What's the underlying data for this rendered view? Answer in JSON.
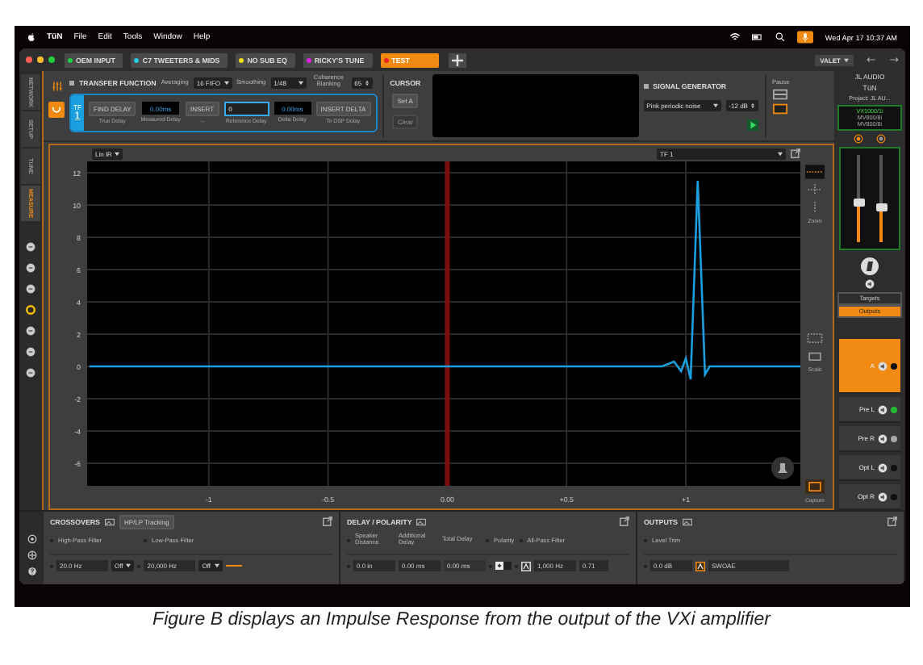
{
  "menu_bar": {
    "app_name": "TüN",
    "items": [
      "File",
      "Edit",
      "Tools",
      "Window",
      "Help"
    ],
    "clock": "Wed Apr 17  10:37 AM"
  },
  "tabs": [
    {
      "label": "OEM INPUT",
      "color": "#22cc44",
      "selected": false
    },
    {
      "label": "C7 TWEETERS & MIDS",
      "color": "#22ccdd",
      "selected": false
    },
    {
      "label": "NO SUB EQ",
      "color": "#eedd22",
      "selected": false
    },
    {
      "label": "RICKY'S TUNE",
      "color": "#dd22dd",
      "selected": false
    },
    {
      "label": "TEST",
      "color": "#ee2222",
      "selected": true
    }
  ],
  "account": "VALET",
  "side_nav": [
    {
      "label": "NETWORK",
      "selected": false
    },
    {
      "label": "SETUP",
      "selected": false
    },
    {
      "label": "TUNE",
      "selected": false
    },
    {
      "label": "MEASURE",
      "selected": true
    }
  ],
  "transfer_function": {
    "title": "TRANSFER FUNCTION",
    "averaging_label": "Averaging",
    "averaging": "16 FIFO",
    "smoothing_label": "Smoothing",
    "smoothing": "1/48",
    "coherence_label": "Coherence Blanking",
    "coherence": "65",
    "tf_label": "TF",
    "tf_number": "1",
    "find_delay": "FIND DELAY",
    "find_delay_caption": "True Delay",
    "measured": "0.00ms",
    "measured_caption": "Measured Delay",
    "insert": "INSERT",
    "insert_caption": "→",
    "reference": "0",
    "reference_caption": "Reference Delay",
    "delta": "0.00ms",
    "delta_caption": "Delta Delay",
    "insert_delta": "INSERT DELTA",
    "insert_delta_caption": "To DSP Delay"
  },
  "cursor": {
    "title": "CURSOR",
    "set": "Set A",
    "clear": "Clear",
    "clear_disabled": true
  },
  "signal_generator": {
    "title": "SIGNAL GENERATOR",
    "signal": "Pink periodic noise",
    "level": "-12 dB",
    "pause_label": "Pause"
  },
  "chart": {
    "view": "Lin IR",
    "zoom_label": "Zoom",
    "scale_label": "Scale",
    "capture_label": "Capture",
    "chart_data": {
      "type": "line",
      "grid": true,
      "x": [
        -1.5,
        0.9,
        0.95,
        0.98,
        1.0,
        1.02,
        1.05,
        1.08,
        1.1,
        1.48
      ],
      "series": [
        {
          "name": "TF 1",
          "color": "#1a9fe0",
          "values": [
            0,
            0,
            0.3,
            -0.3,
            0.5,
            -0.8,
            11.5,
            -0.5,
            0,
            0
          ]
        }
      ],
      "xlim": [
        -1.51,
        1.48
      ],
      "ylim": [
        -7.4,
        12.7
      ],
      "xticks": [
        {
          "value": -1,
          "label": "-1"
        },
        {
          "value": -0.5,
          "label": "-0.5"
        },
        {
          "value": 0,
          "label": "0.00"
        },
        {
          "value": 0.5,
          "label": "+0.5"
        },
        {
          "value": 1,
          "label": "+1"
        }
      ],
      "yticks": [
        12,
        10,
        8,
        6,
        4,
        2,
        0,
        -2,
        -4,
        -6
      ]
    }
  },
  "right_panel": {
    "brand": "JL AUDIO",
    "product": "TüN",
    "project": "Project: JL AU...",
    "devices": [
      {
        "name": "VX1000/1i",
        "selected": true
      },
      {
        "name": "MV800/8i",
        "selected": false
      },
      {
        "name": "MV800/8i",
        "selected": false
      }
    ],
    "sliders": [
      {
        "level": 0.45
      },
      {
        "level": 0.4
      }
    ],
    "views": [
      {
        "label": "Targets",
        "selected": false
      },
      {
        "label": "Outputs",
        "selected": true
      }
    ],
    "channels": [
      {
        "name": "A",
        "selected": true,
        "color": "#111111"
      },
      {
        "name": "Pre L",
        "selected": false,
        "color": "#22bb33"
      },
      {
        "name": "Pre R",
        "selected": false,
        "color": "#aaaaaa"
      },
      {
        "name": "Opt L",
        "selected": false,
        "color": "#111111"
      },
      {
        "name": "Opt R",
        "selected": false,
        "color": "#111111"
      }
    ]
  },
  "crossovers": {
    "title": "CROSSOVERS",
    "tracking": "HP/LP Tracking",
    "hp_label": "High-Pass Filter",
    "lp_label": "Low-Pass Filter",
    "hp_freq": "20.0 Hz",
    "hp_slope": "Off",
    "lp_freq": "20,000 Hz",
    "lp_slope": "Off"
  },
  "delay": {
    "title": "DELAY / POLARITY",
    "labels": [
      "Speaker Distance",
      "Additional Delay",
      "Total Delay"
    ],
    "polarity_label": "Polarity",
    "allpass_label": "All-Pass Filter",
    "distance": "0.0 in",
    "additional": "0.00 ms",
    "total": "0.00 ms",
    "allpass_freq": "1,000 Hz",
    "allpass_q": "0.71"
  },
  "outputs": {
    "title": "OUTPUTS",
    "level_label": "Level Trim",
    "level": "0.0 dB",
    "name": "SWOAE"
  },
  "caption": "Figure B displays an Impulse Response from the output of the VXi amplifier"
}
